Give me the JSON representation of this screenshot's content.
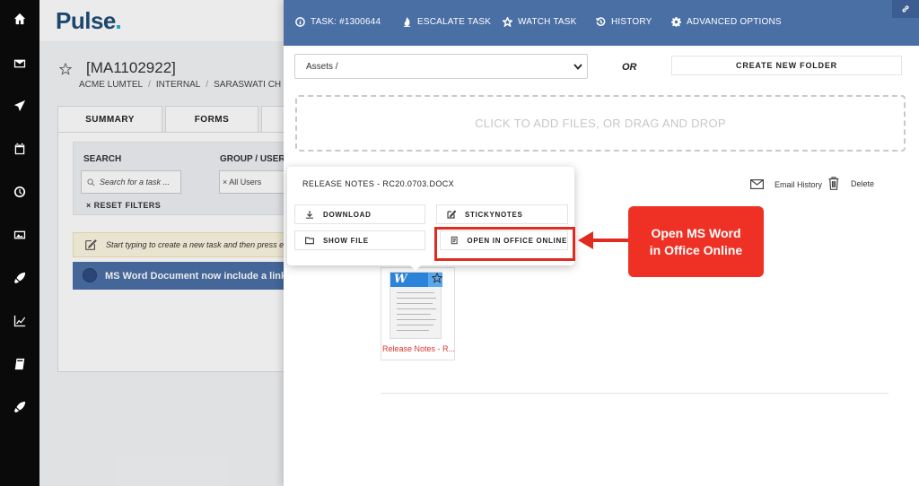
{
  "app": {
    "logo": "Pulse"
  },
  "nav": [
    {
      "name": "home-icon"
    },
    {
      "name": "mail-icon"
    },
    {
      "name": "send-icon"
    },
    {
      "name": "calendar-icon"
    },
    {
      "name": "clock-icon"
    },
    {
      "name": "image-icon"
    },
    {
      "name": "rocket-icon"
    },
    {
      "name": "chart-icon"
    },
    {
      "name": "book-icon"
    },
    {
      "name": "launch-icon"
    }
  ],
  "task": {
    "code": "[MA1102922]",
    "crumbs": [
      "ACME LUMTEL",
      "INTERNAL",
      "SARASWATI CH"
    ]
  },
  "tabs": [
    "SUMMARY",
    "FORMS"
  ],
  "filters": {
    "search_label": "SEARCH",
    "search_placeholder": "Search for a task ...",
    "group_label": "GROUP / USER",
    "group_value": "× All Users",
    "reset": "RESET FILTERS"
  },
  "hint": "Start typing to create a new task and then press er",
  "notice": "MS Word Document now include a link",
  "panel": {
    "header": {
      "task_id": "TASK: #1300644",
      "escalate": "ESCALATE TASK",
      "watch": "WATCH TASK",
      "history": "HISTORY",
      "advanced": "ADVANCED OPTIONS"
    },
    "folder_select": "Assets /",
    "or": "OR",
    "create_folder": "CREATE NEW FOLDER",
    "dropzone": "CLICK TO ADD FILES, OR DRAG AND DROP",
    "email_history": "Email History",
    "delete": "Delete",
    "file_name": "Release Notes - R..."
  },
  "popup": {
    "title": "RELEASE NOTES - RC20.0703.DOCX",
    "download": "DOWNLOAD",
    "stickynotes": "STICKYNOTES",
    "show_file": "SHOW FILE",
    "open_online": "OPEN IN OFFICE ONLINE"
  },
  "annotation": {
    "line1": "Open MS Word",
    "line2": "in Office Online"
  },
  "colors": {
    "header_blue": "#4a6fa5",
    "annotation_red": "#ee3124",
    "file_name_red": "#d9362b"
  }
}
